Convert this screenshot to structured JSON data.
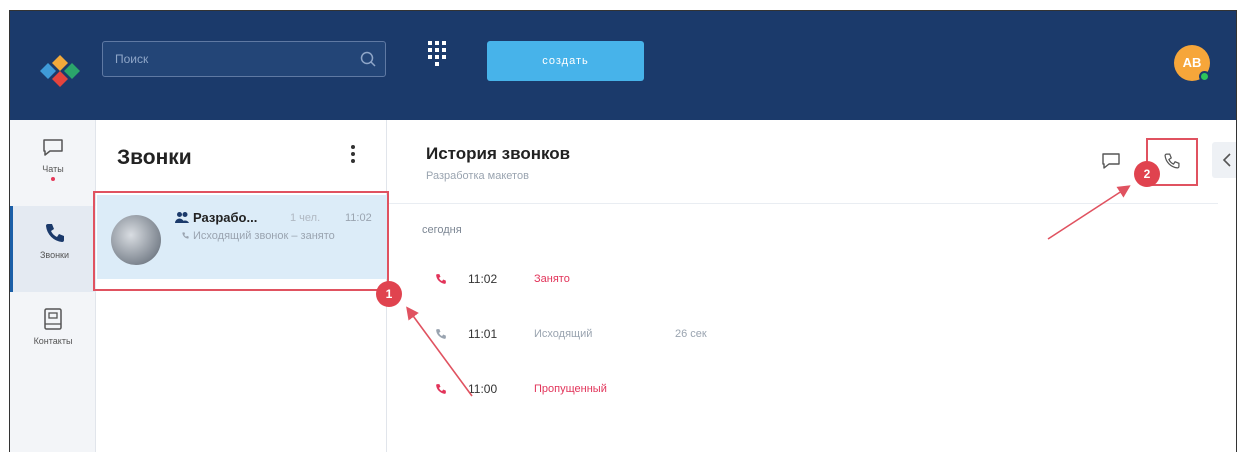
{
  "header": {
    "search_placeholder": "Поиск",
    "create_label": "создать",
    "avatar_initials": "АВ"
  },
  "rail": {
    "items": [
      {
        "label": "Чаты",
        "icon": "chat-icon",
        "has_dot": true
      },
      {
        "label": "Звонки",
        "icon": "phone-icon",
        "active": true
      },
      {
        "label": "Контакты",
        "icon": "contacts-book-icon"
      }
    ]
  },
  "calls_list": {
    "title": "Звонки",
    "rows": [
      {
        "name": "Разрабо...",
        "meta": "1 чел.",
        "time": "11:02",
        "subtitle": "Исходящий звонок – занято"
      }
    ]
  },
  "history": {
    "title": "История звонков",
    "subtitle": "Разработка макетов",
    "day_label": "сегодня",
    "calls": [
      {
        "time": "11:02",
        "status": "Занято",
        "duration": "",
        "status_color": "#e2345a"
      },
      {
        "time": "11:01",
        "status": "Исходящий",
        "duration": "26 сек",
        "status_color": "#9aa4b0"
      },
      {
        "time": "11:00",
        "status": "Пропущенный",
        "duration": "",
        "status_color": "#e2345a"
      }
    ]
  },
  "annotations": {
    "badge_1": "1",
    "badge_2": "2"
  },
  "colors": {
    "header_bg": "#1b3a6b",
    "accent": "#47b3ea",
    "missed": "#e2345a",
    "callout": "#e05260"
  }
}
